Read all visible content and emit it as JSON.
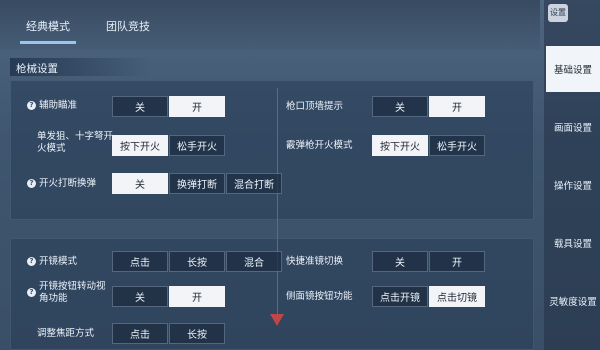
{
  "top_tabs": [
    "经典模式",
    "团队竞技"
  ],
  "settings_label": "设置",
  "section": "枪械设置",
  "sidebar": [
    "基础设置",
    "画面设置",
    "操作设置",
    "载具设置",
    "灵敏度设置"
  ],
  "left_rows": [
    {
      "label": "辅助瞄准",
      "options": [
        "关",
        "开"
      ],
      "selected": 1
    },
    {
      "label": "单发狙、十字弩开火模式",
      "options": [
        "按下开火",
        "松手开火"
      ],
      "selected": 0
    },
    {
      "label": "开火打断换弹",
      "options": [
        "关",
        "换弹打断",
        "混合打断"
      ],
      "selected": 0
    }
  ],
  "right_rows": [
    {
      "label": "枪口顶墙提示",
      "options": [
        "关",
        "开"
      ],
      "selected": 1
    },
    {
      "label": "霰弹枪开火模式",
      "options": [
        "按下开火",
        "松手开火"
      ],
      "selected": 0
    }
  ],
  "lower_left_rows": [
    {
      "label": "开镜模式",
      "options": [
        "点击",
        "长按",
        "混合"
      ],
      "selected": null
    },
    {
      "label": "开镜按钮转动视角功能",
      "options": [
        "关",
        "开"
      ],
      "selected": 1
    },
    {
      "label": "调整焦距方式",
      "options": [
        "点击",
        "长按"
      ],
      "selected": null
    }
  ],
  "lower_right_rows": [
    {
      "label": "快捷准镜切换",
      "options": [
        "关",
        "开"
      ],
      "selected": null
    },
    {
      "label": "侧面镜按钮功能",
      "options": [
        "点击开镜",
        "点击切镜"
      ],
      "selected": 1
    }
  ]
}
